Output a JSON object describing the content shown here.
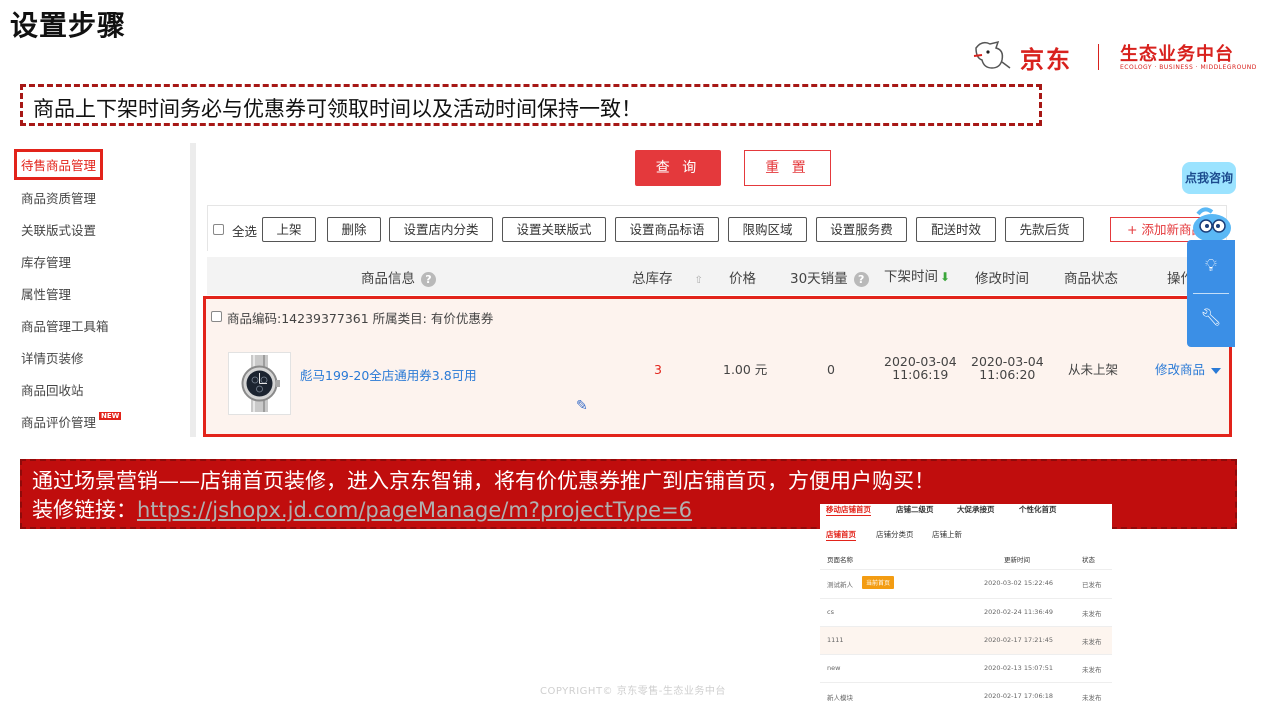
{
  "slide": {
    "title": "设置步骤",
    "notice": "商品上下架时间务必与优惠券可领取时间以及活动时间保持一致！",
    "banner_line1": "通过场景营销——店铺首页装修，进入京东智铺，将有价优惠券推广到店铺首页，方便用户购买！",
    "banner_line2_label": "装修链接：",
    "banner_link": "https://jshopx.jd.com/pageManage/m?projectType=6",
    "copyright": "COPYRIGHT© 京东零售-生态业务中台"
  },
  "brand": {
    "jd": "京东",
    "eco": "生态业务中台",
    "eco_en": "ECOLOGY · BUSINESS · MIDDLEGROUND",
    "color": "#d8211d"
  },
  "sidebar": {
    "items": [
      {
        "label": "待售商品管理",
        "active": true
      },
      {
        "label": "商品资质管理"
      },
      {
        "label": "关联版式设置"
      },
      {
        "label": "库存管理"
      },
      {
        "label": "属性管理"
      },
      {
        "label": "商品管理工具箱"
      },
      {
        "label": "详情页装修"
      },
      {
        "label": "商品回收站"
      },
      {
        "label": "商品评价管理",
        "badge": "NEW"
      }
    ]
  },
  "search": {
    "query_label": "查 询",
    "reset_label": "重 置"
  },
  "toolbar": {
    "select_all": "全选",
    "buttons": [
      "上架",
      "删除",
      "设置店内分类",
      "设置关联版式",
      "设置商品标语",
      "限购区域",
      "设置服务费",
      "配送时效",
      "先款后货"
    ],
    "add_label": "+ 添加新商品"
  },
  "table": {
    "headers": {
      "info": "商品信息",
      "stock": "总库存",
      "price": "价格",
      "sales30": "30天销量",
      "offtime": "下架时间",
      "modtime": "修改时间",
      "status": "商品状态",
      "ops": "操作"
    },
    "row": {
      "meta": "商品编码:14239377361 所属类目: 有价优惠券",
      "name": "彪马199-20全店通用券3.8可用",
      "stock": "3",
      "price": "1.00 元",
      "sales": "0",
      "offtime_date": "2020-03-04",
      "offtime_time": "11:06:19",
      "modtime_date": "2020-03-04",
      "modtime_time": "11:06:20",
      "status": "从未上架",
      "op": "修改商品"
    }
  },
  "widget": {
    "consult": "点我咨询"
  },
  "inset": {
    "tabs_top": [
      "移动店铺首页",
      "店铺二级页",
      "大促承接页",
      "个性化首页"
    ],
    "tabs_sub": [
      "店铺首页",
      "店铺分类页",
      "店铺上新"
    ],
    "header": {
      "name": "页面名称",
      "time": "更新时间",
      "status": "状态"
    },
    "rows": [
      {
        "name": "测试新人",
        "badge": "当前首页",
        "time": "2020-03-02 15:22:46",
        "status": "已发布"
      },
      {
        "name": "cs",
        "time": "2020-02-24 11:36:49",
        "status": "未发布"
      },
      {
        "name": "1111",
        "time": "2020-02-17 17:21:45",
        "status": "未发布"
      },
      {
        "name": "new",
        "time": "2020-02-13 15:07:51",
        "status": "未发布"
      },
      {
        "name": "新人模块",
        "time": "2020-02-17 17:06:18",
        "status": "未发布"
      }
    ]
  }
}
